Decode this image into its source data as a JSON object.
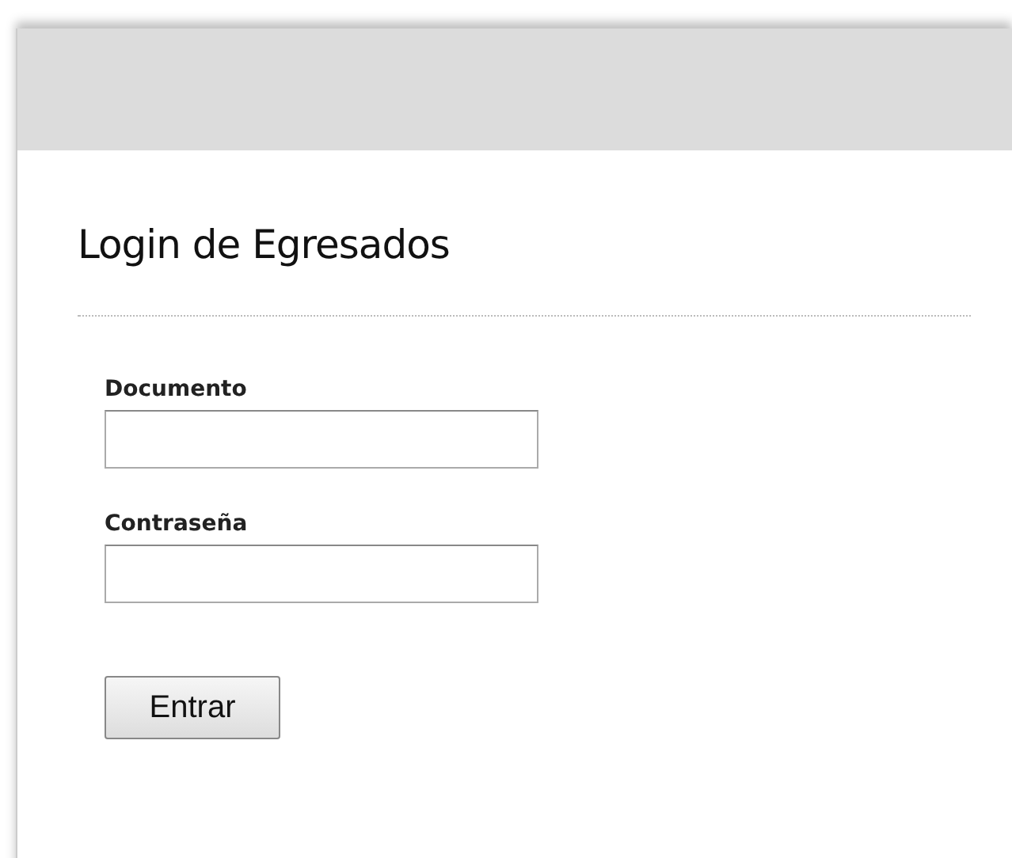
{
  "title": "Login de Egresados",
  "fields": [
    {
      "label": "Documento"
    },
    {
      "label": "Contraseña"
    }
  ],
  "button": "Entrar"
}
